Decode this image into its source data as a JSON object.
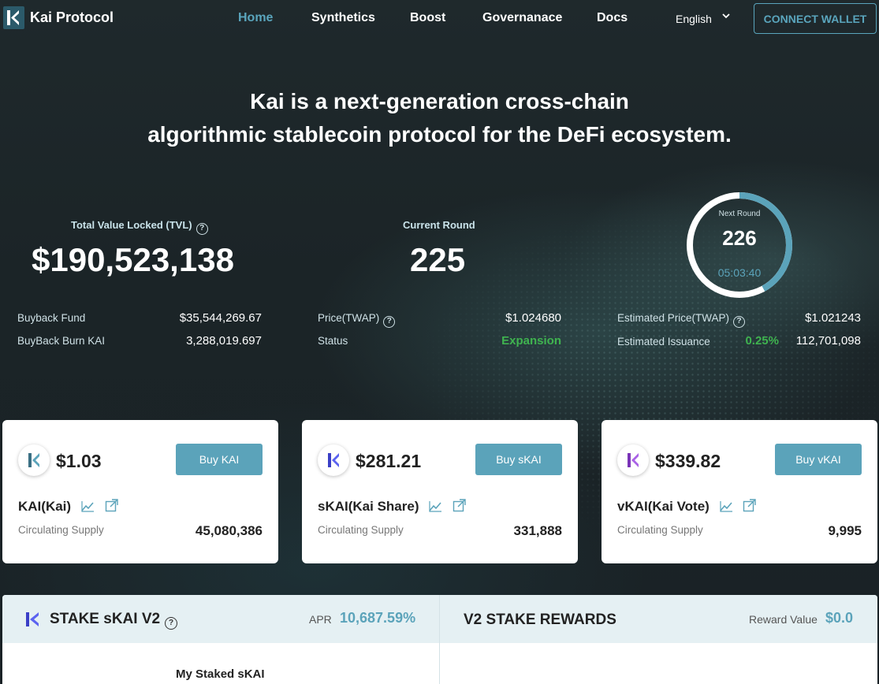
{
  "nav": {
    "brand": "Kai Protocol",
    "links": [
      "Home",
      "Synthetics",
      "Boost",
      "Governanace",
      "Docs"
    ],
    "active": "Home",
    "language": "English",
    "connect_wallet": "CONNECT WALLET"
  },
  "hero": {
    "line1": "Kai is a next-generation cross-chain",
    "line2": "algorithmic stablecoin protocol for the DeFi ecosystem."
  },
  "tvl": {
    "label": "Total Value Locked (TVL)",
    "value": "$190,523,138"
  },
  "current_round": {
    "label": "Current Round",
    "value": "225"
  },
  "next_round": {
    "label": "Next Round",
    "value": "226",
    "timer": "05:03:40",
    "progress": 0.42
  },
  "stats_left": [
    {
      "label": "Buyback Fund",
      "value": "$35,544,269.67"
    },
    {
      "label": "BuyBack Burn KAI",
      "value": "3,288,019.697"
    }
  ],
  "stats_mid": [
    {
      "label": "Price(TWAP)",
      "value": "$1.024680"
    },
    {
      "label": "Status",
      "value": "Expansion"
    }
  ],
  "stats_right": [
    {
      "label": "Estimated Price(TWAP)",
      "value": "$1.021243"
    },
    {
      "label": "Estimated Issuance",
      "pct": "0.25%",
      "value": "112,701,098"
    }
  ],
  "cards": [
    {
      "price": "$1.03",
      "buy": "Buy KAI",
      "name": "KAI(Kai)",
      "supply_label": "Circulating Supply",
      "supply": "45,080,386",
      "color": "#5ba3ba"
    },
    {
      "price": "$281.21",
      "buy": "Buy sKAI",
      "name": "sKAI(Kai Share)",
      "supply_label": "Circulating Supply",
      "supply": "331,888",
      "color": "#4a4ee0"
    },
    {
      "price": "$339.82",
      "buy": "Buy vKAI",
      "name": "vKAI(Kai Vote)",
      "supply_label": "Circulating Supply",
      "supply": "9,995",
      "color": "#9b4fd6"
    }
  ],
  "stake": {
    "title": "STAKE sKAI V2",
    "apr_label": "APR",
    "apr": "10,687.59%",
    "my_staked": "My Staked sKAI",
    "rewards_title": "V2 STAKE REWARDS",
    "reward_label": "Reward Value",
    "reward_value": "$0.0"
  }
}
